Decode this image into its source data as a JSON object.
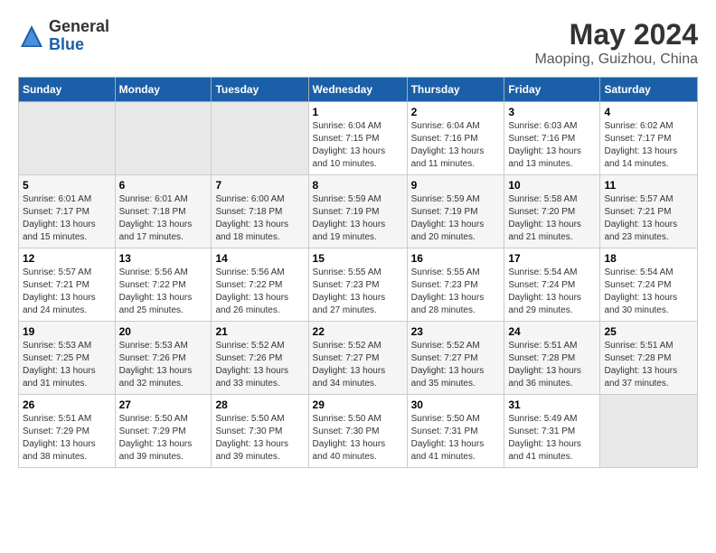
{
  "header": {
    "logo_general": "General",
    "logo_blue": "Blue",
    "title": "May 2024",
    "subtitle": "Maoping, Guizhou, China"
  },
  "days_of_week": [
    "Sunday",
    "Monday",
    "Tuesday",
    "Wednesday",
    "Thursday",
    "Friday",
    "Saturday"
  ],
  "weeks": [
    [
      {
        "num": "",
        "empty": true
      },
      {
        "num": "",
        "empty": true
      },
      {
        "num": "",
        "empty": true
      },
      {
        "num": "1",
        "sunrise": "6:04 AM",
        "sunset": "7:15 PM",
        "daylight": "13 hours and 10 minutes."
      },
      {
        "num": "2",
        "sunrise": "6:04 AM",
        "sunset": "7:16 PM",
        "daylight": "13 hours and 11 minutes."
      },
      {
        "num": "3",
        "sunrise": "6:03 AM",
        "sunset": "7:16 PM",
        "daylight": "13 hours and 13 minutes."
      },
      {
        "num": "4",
        "sunrise": "6:02 AM",
        "sunset": "7:17 PM",
        "daylight": "13 hours and 14 minutes."
      }
    ],
    [
      {
        "num": "5",
        "sunrise": "6:01 AM",
        "sunset": "7:17 PM",
        "daylight": "13 hours and 15 minutes."
      },
      {
        "num": "6",
        "sunrise": "6:01 AM",
        "sunset": "7:18 PM",
        "daylight": "13 hours and 17 minutes."
      },
      {
        "num": "7",
        "sunrise": "6:00 AM",
        "sunset": "7:18 PM",
        "daylight": "13 hours and 18 minutes."
      },
      {
        "num": "8",
        "sunrise": "5:59 AM",
        "sunset": "7:19 PM",
        "daylight": "13 hours and 19 minutes."
      },
      {
        "num": "9",
        "sunrise": "5:59 AM",
        "sunset": "7:19 PM",
        "daylight": "13 hours and 20 minutes."
      },
      {
        "num": "10",
        "sunrise": "5:58 AM",
        "sunset": "7:20 PM",
        "daylight": "13 hours and 21 minutes."
      },
      {
        "num": "11",
        "sunrise": "5:57 AM",
        "sunset": "7:21 PM",
        "daylight": "13 hours and 23 minutes."
      }
    ],
    [
      {
        "num": "12",
        "sunrise": "5:57 AM",
        "sunset": "7:21 PM",
        "daylight": "13 hours and 24 minutes."
      },
      {
        "num": "13",
        "sunrise": "5:56 AM",
        "sunset": "7:22 PM",
        "daylight": "13 hours and 25 minutes."
      },
      {
        "num": "14",
        "sunrise": "5:56 AM",
        "sunset": "7:22 PM",
        "daylight": "13 hours and 26 minutes."
      },
      {
        "num": "15",
        "sunrise": "5:55 AM",
        "sunset": "7:23 PM",
        "daylight": "13 hours and 27 minutes."
      },
      {
        "num": "16",
        "sunrise": "5:55 AM",
        "sunset": "7:23 PM",
        "daylight": "13 hours and 28 minutes."
      },
      {
        "num": "17",
        "sunrise": "5:54 AM",
        "sunset": "7:24 PM",
        "daylight": "13 hours and 29 minutes."
      },
      {
        "num": "18",
        "sunrise": "5:54 AM",
        "sunset": "7:24 PM",
        "daylight": "13 hours and 30 minutes."
      }
    ],
    [
      {
        "num": "19",
        "sunrise": "5:53 AM",
        "sunset": "7:25 PM",
        "daylight": "13 hours and 31 minutes."
      },
      {
        "num": "20",
        "sunrise": "5:53 AM",
        "sunset": "7:26 PM",
        "daylight": "13 hours and 32 minutes."
      },
      {
        "num": "21",
        "sunrise": "5:52 AM",
        "sunset": "7:26 PM",
        "daylight": "13 hours and 33 minutes."
      },
      {
        "num": "22",
        "sunrise": "5:52 AM",
        "sunset": "7:27 PM",
        "daylight": "13 hours and 34 minutes."
      },
      {
        "num": "23",
        "sunrise": "5:52 AM",
        "sunset": "7:27 PM",
        "daylight": "13 hours and 35 minutes."
      },
      {
        "num": "24",
        "sunrise": "5:51 AM",
        "sunset": "7:28 PM",
        "daylight": "13 hours and 36 minutes."
      },
      {
        "num": "25",
        "sunrise": "5:51 AM",
        "sunset": "7:28 PM",
        "daylight": "13 hours and 37 minutes."
      }
    ],
    [
      {
        "num": "26",
        "sunrise": "5:51 AM",
        "sunset": "7:29 PM",
        "daylight": "13 hours and 38 minutes."
      },
      {
        "num": "27",
        "sunrise": "5:50 AM",
        "sunset": "7:29 PM",
        "daylight": "13 hours and 39 minutes."
      },
      {
        "num": "28",
        "sunrise": "5:50 AM",
        "sunset": "7:30 PM",
        "daylight": "13 hours and 39 minutes."
      },
      {
        "num": "29",
        "sunrise": "5:50 AM",
        "sunset": "7:30 PM",
        "daylight": "13 hours and 40 minutes."
      },
      {
        "num": "30",
        "sunrise": "5:50 AM",
        "sunset": "7:31 PM",
        "daylight": "13 hours and 41 minutes."
      },
      {
        "num": "31",
        "sunrise": "5:49 AM",
        "sunset": "7:31 PM",
        "daylight": "13 hours and 41 minutes."
      },
      {
        "num": "",
        "empty": true
      }
    ]
  ]
}
